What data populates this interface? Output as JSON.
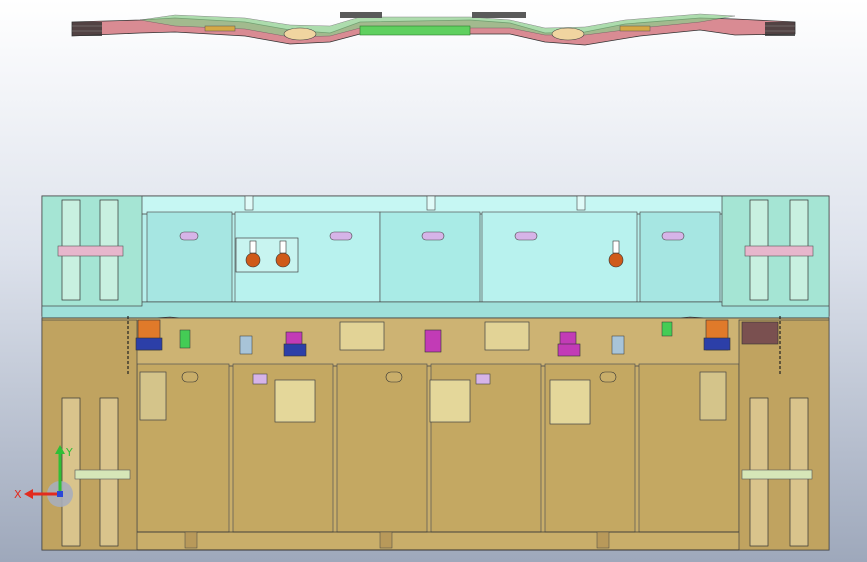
{
  "window": {
    "view": "cad-3d-viewport"
  },
  "colors": {
    "background_top": "#ffffff",
    "background_bottom": "#9ea8bb",
    "upper_die": "#b6f0ec",
    "lower_die": "#c9ae6a",
    "blank_strip": "#d98b93",
    "accent_green": "#44cc55",
    "guide_pin": "#e7b6cc",
    "cylinder": "#d4c48a",
    "bolt_head": "#cf5a1a",
    "spring_orange": "#e07a2a",
    "spring_blue": "#2c3fa8",
    "part_magenta": "#c23bb6",
    "axis_x": "#e22b1f",
    "axis_y": "#2fbf36",
    "axis_z": "#2a47d8"
  },
  "icons": {
    "triad": "coordinate-axes-icon"
  },
  "triad": {
    "x_label": "X",
    "y_label": "Y"
  }
}
